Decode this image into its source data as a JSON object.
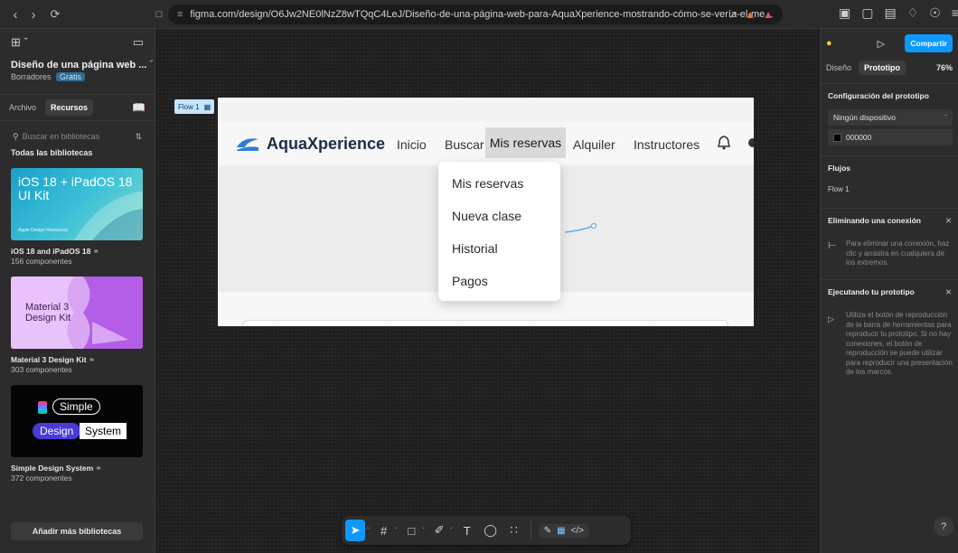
{
  "browser": {
    "url": "figma.com/design/O6Jw2NE0lNzZ8wTQqC4LeJ/Diseño-de-una-página-web-para-AquaXperience-mostrando-cómo-se-vería-el-me..."
  },
  "left_panel": {
    "file_title": "Diseño de una página web ...",
    "drafts_label": "Borradores",
    "plan_badge": "Gratis",
    "tabs": [
      "Archivo",
      "Recursos"
    ],
    "active_tab": "Recursos",
    "search_placeholder": "Buscar en bibliotecas",
    "libraries_heading": "Todas las bibliotecas",
    "libraries": [
      {
        "name": "iOS 18 and iPadOS 18",
        "count": "156 componentes",
        "thumb_title": "iOS 18 + iPadOS 18 UI Kit",
        "thumb_caption": "Apple Design Resources"
      },
      {
        "name": "Material 3 Design Kit",
        "count": "303 componentes",
        "thumb_title": "Material 3 Design Kit"
      },
      {
        "name": "Simple Design System",
        "count": "372 componentes",
        "thumb_words": [
          "Simple",
          "Design",
          "System"
        ]
      }
    ],
    "add_button": "Añadir más bibliotecas"
  },
  "canvas": {
    "flow_tag": "Flow 1",
    "site": {
      "brand": "AquaXperience",
      "nav": [
        "Inicio",
        "Buscar",
        "Mis reservas",
        "Alquiler",
        "Instructores"
      ],
      "active_nav": "Mis reservas",
      "dropdown": [
        "Mis reservas",
        "Nueva clase",
        "Historial",
        "Pagos"
      ]
    }
  },
  "toolbar": {
    "tools": [
      "move-tool",
      "frame-tool",
      "shape-tool",
      "pen-tool",
      "text-tool",
      "comment-tool",
      "actions-tool"
    ],
    "text_tool_glyph": "T"
  },
  "right_panel": {
    "share_button": "Compartir",
    "tabs": [
      "Diseño",
      "Prototipo"
    ],
    "active_tab": "Prototipo",
    "zoom": "76%",
    "prototype_config_heading": "Configuración del prototipo",
    "device": "Ningún dispositivo",
    "background_color": "000000",
    "flows_heading": "Flujos",
    "flow_name": "Flow 1",
    "remove_connection_heading": "Eliminando una conexión",
    "remove_connection_text": "Para eliminar una conexión, haz clic y arrastra en cualquiera de los extremos.",
    "run_prototype_heading": "Ejecutando tu prototipo",
    "run_prototype_text": "Utiliza el botón de reproducción de la barra de herramientas para reproducir tu prototipo. Si no hay conexiones, el botón de reproducción se puede utilizar para reproducir una presentación de los marcos.",
    "help_label": "?"
  },
  "colors": {
    "accent": "#0d99ff",
    "brand_navy": "#1a2e49",
    "brand_blue": "#2f7fd1"
  }
}
